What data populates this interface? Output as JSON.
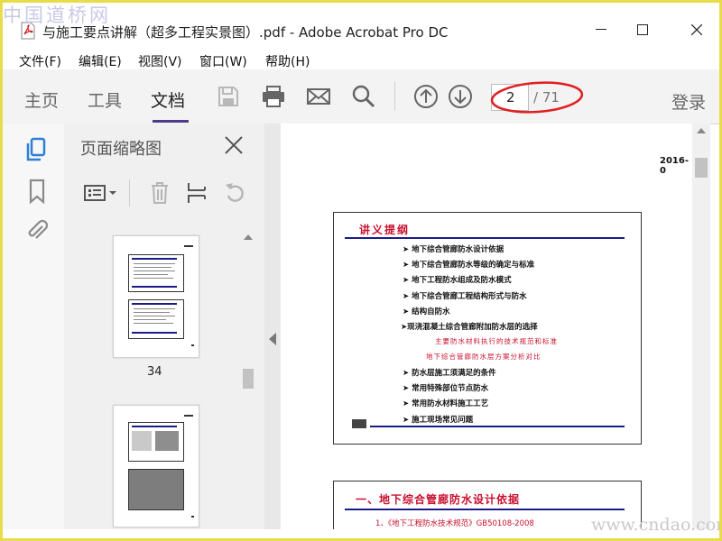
{
  "watermark": {
    "top": "中国道桥网",
    "bottom": "www.cndao.com"
  },
  "window": {
    "title": "与施工要点讲解（超多工程实景图）.pdf - Adobe Acrobat Pro DC"
  },
  "menu": {
    "items": [
      "文件(F)",
      "编辑(E)",
      "视图(V)",
      "窗口(W)",
      "帮助(H)"
    ]
  },
  "toolbar": {
    "tabs": [
      "主页",
      "工具",
      "文档"
    ],
    "active_tab": "文档",
    "page_current": "2",
    "page_total": "/ 71",
    "login": "登录"
  },
  "panel": {
    "title": "页面缩略图",
    "thumbnail_label": "34"
  },
  "document": {
    "date": "2016-0",
    "outline_title": "讲义提纲",
    "outline_items": [
      "➤ 地下综合管廊防水设计依据",
      "➤ 地下综合管廊防水等级的确定与标准",
      "➤ 地下工程防水组成及防水模式",
      "➤ 地下综合管廊工程结构形式与防水",
      "➤ 结构自防水",
      "➤现浇混凝土综合管廊附加防水层的选择"
    ],
    "outline_sub": [
      "主要防水材料执行的技术规范和标准",
      "地下综合管廊防水层方案分析对比"
    ],
    "outline_items2": [
      "➤ 防水层施工须满足的条件",
      "➤ 常用特殊部位节点防水",
      "➤ 常用防水材料施工工艺",
      "➤ 施工现场常见问题"
    ],
    "next_title": "一、地下综合管廊防水设计依据",
    "next_item": "1、《地下工程防水技术规范》GB50108-2008"
  },
  "colors": {
    "accent": "#4e3b8a",
    "icon_blue": "#2d7fd8",
    "slide_red": "#c8102e",
    "annotation_red": "#e02020",
    "frame_yellow": "#e8dc4a"
  }
}
